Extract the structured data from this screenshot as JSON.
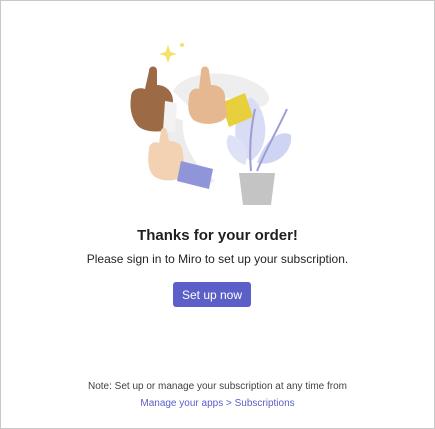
{
  "dialog": {
    "title": "Thanks for your order!",
    "message": "Please sign in to Miro to set up your subscription.",
    "primary_button": "Set up now",
    "note": "Note: Set up or manage your subscription at any time from",
    "link": {
      "apps": "Manage your apps",
      "separator": " > ",
      "subscriptions": "Subscriptions"
    }
  },
  "illustration": {
    "name": "thumbs-up-hands-illustration"
  },
  "colors": {
    "accent": "#5b5fc7",
    "title_text": "#1f1f1f",
    "note_text": "#424242",
    "border": "#c8c8c8"
  }
}
